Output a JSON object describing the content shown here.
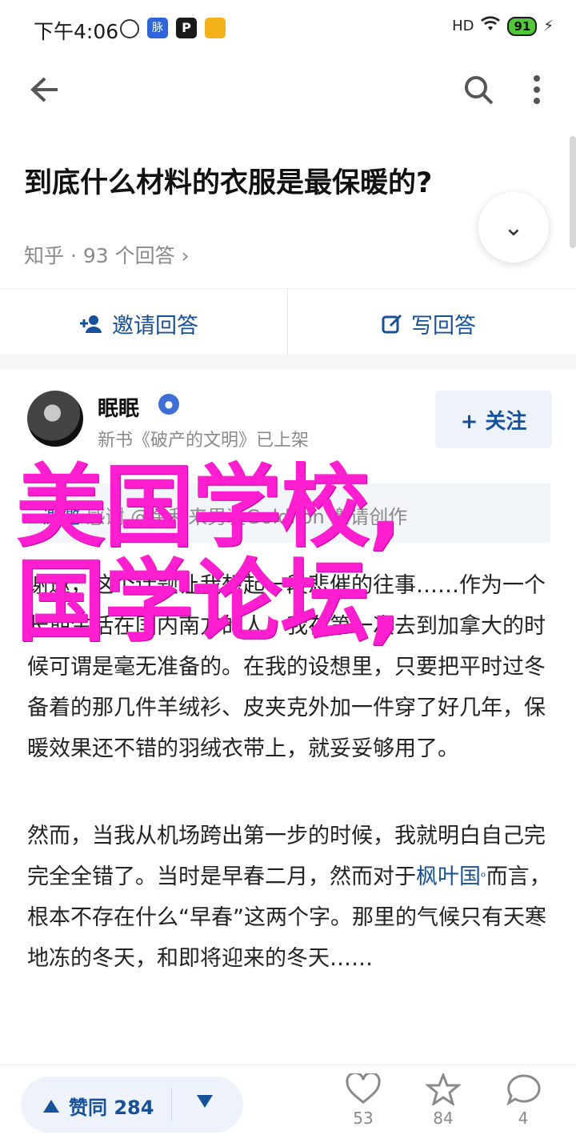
{
  "status": {
    "time": "下午4:06",
    "notif_1": "脉",
    "notif_2": "P",
    "network": "HD",
    "battery": "91"
  },
  "question": {
    "title": "到底什么材料的衣服是最保暖的?",
    "meta": "知乎 · 93 个回答 ›"
  },
  "actions": {
    "invite": "邀请回答",
    "write": "写回答"
  },
  "answer": {
    "author": "眠眠",
    "author_meta": "新书《破产的文明》已上架",
    "follow": "+ 关注",
    "invite_prefix": "谢邀",
    "invite_rest": " 感谢 @金利来男装Goldlion 邀请创作",
    "para1": "谢邀，这个话题让我想起一段悲催的往事……作为一个长期生活在国内南方的人，我在第一次去到加拿大的时候可谓是毫无准备的。在我的设想里，只要把平时过冬备着的那几件羊绒衫、皮夹克外加一件穿了好几年，保暖效果还不错的羽绒衣带上，就妥妥够用了。",
    "para2_a": "然而，当我从机场跨出第一步的时候，我就明白自己完完全全错了。当时是早春二月，然而对于",
    "para2_link": "枫叶国",
    "para2_b": "而言，根本不存在什么“早春”这两个字。那里的气候只有天寒地冻的冬天，和即将迎来的冬天……"
  },
  "watermark": {
    "line1": "美国学校,",
    "line2": "国学论坛,"
  },
  "bottom": {
    "vote_label": "赞同 284",
    "likes": "53",
    "favorites": "84",
    "comments": "4"
  }
}
